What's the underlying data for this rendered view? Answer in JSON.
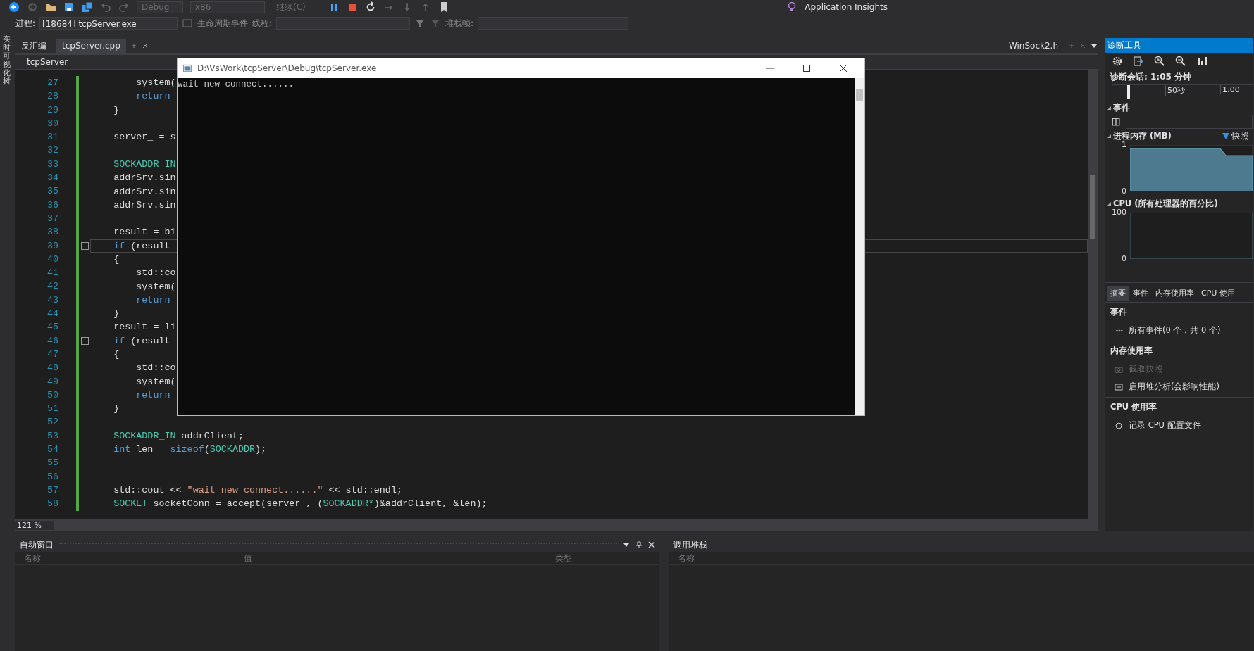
{
  "toolbar": {
    "items": [
      {
        "label": "Debug",
        "disabled": true
      },
      {
        "label": "x86",
        "disabled": true
      },
      {
        "label": "继续(C)",
        "disabled": true
      }
    ],
    "insights": "Application Insights"
  },
  "debug_bar": {
    "process_label": "进程:",
    "process": "[18684] tcpServer.exe",
    "lifecycle": "生命周期事件",
    "thread_label": "线程:",
    "stack_label": "堆栈帧:"
  },
  "side_strip": {
    "label": "实时可视化树"
  },
  "tabs": [
    {
      "label": "反汇编",
      "selected": false
    },
    {
      "label": "tcpServer.cpp",
      "selected": true
    }
  ],
  "right_tab": {
    "label": "WinSock2.h"
  },
  "nav": {
    "project": "tcpServer"
  },
  "code": {
    "lines": [
      {
        "number": "27",
        "fold": false,
        "current": false,
        "tokens": [
          {
            "text": "        system(",
            "kind": "plain"
          }
        ]
      },
      {
        "number": "28",
        "fold": false,
        "current": false,
        "tokens": [
          {
            "text": "        return",
            "kind": "keyword"
          }
        ]
      },
      {
        "number": "29",
        "fold": false,
        "current": false,
        "tokens": [
          {
            "text": "    }",
            "kind": "plain"
          }
        ]
      },
      {
        "number": "30",
        "fold": false,
        "current": false
      },
      {
        "number": "31",
        "fold": false,
        "current": false,
        "tokens": [
          {
            "text": "    server_ = s",
            "kind": "plain"
          }
        ]
      },
      {
        "number": "32",
        "fold": false,
        "current": false
      },
      {
        "number": "33",
        "fold": false,
        "current": false,
        "tokens": [
          {
            "text": "    SOCKADDR_IN",
            "kind": "type"
          }
        ]
      },
      {
        "number": "34",
        "fold": false,
        "current": false,
        "tokens": [
          {
            "text": "    addrSrv.sin",
            "kind": "plain"
          }
        ]
      },
      {
        "number": "35",
        "fold": false,
        "current": false,
        "tokens": [
          {
            "text": "    addrSrv.sin",
            "kind": "plain"
          }
        ]
      },
      {
        "number": "36",
        "fold": false,
        "current": false,
        "tokens": [
          {
            "text": "    addrSrv.sin",
            "kind": "plain"
          }
        ]
      },
      {
        "number": "37",
        "fold": false,
        "current": false
      },
      {
        "number": "38",
        "fold": false,
        "current": false,
        "tokens": [
          {
            "text": "    result = bi",
            "kind": "plain"
          }
        ]
      },
      {
        "number": "39",
        "fold": true,
        "current": true,
        "tokens": [
          {
            "text": "    if",
            "kind": "keyword"
          },
          {
            "text": " (result",
            "kind": "plain"
          }
        ]
      },
      {
        "number": "40",
        "fold": false,
        "current": false,
        "tokens": [
          {
            "text": "    {",
            "kind": "plain"
          }
        ]
      },
      {
        "number": "41",
        "fold": false,
        "current": false,
        "tokens": [
          {
            "text": "        std::co",
            "kind": "plain"
          }
        ]
      },
      {
        "number": "42",
        "fold": false,
        "current": false,
        "tokens": [
          {
            "text": "        system(",
            "kind": "plain"
          }
        ]
      },
      {
        "number": "43",
        "fold": false,
        "current": false,
        "tokens": [
          {
            "text": "        return",
            "kind": "keyword"
          }
        ]
      },
      {
        "number": "44",
        "fold": false,
        "current": false,
        "tokens": [
          {
            "text": "    }",
            "kind": "plain"
          }
        ]
      },
      {
        "number": "45",
        "fold": false,
        "current": false,
        "tokens": [
          {
            "text": "    result = li",
            "kind": "plain"
          }
        ]
      },
      {
        "number": "46",
        "fold": true,
        "current": false,
        "tokens": [
          {
            "text": "    if",
            "kind": "keyword"
          },
          {
            "text": " (result",
            "kind": "plain"
          }
        ]
      },
      {
        "number": "47",
        "fold": false,
        "current": false,
        "tokens": [
          {
            "text": "    {",
            "kind": "plain"
          }
        ]
      },
      {
        "number": "48",
        "fold": false,
        "current": false,
        "tokens": [
          {
            "text": "        std::co",
            "kind": "plain"
          }
        ]
      },
      {
        "number": "49",
        "fold": false,
        "current": false,
        "tokens": [
          {
            "text": "        system(",
            "kind": "plain"
          }
        ]
      },
      {
        "number": "50",
        "fold": false,
        "current": false,
        "tokens": [
          {
            "text": "        return",
            "kind": "keyword"
          }
        ]
      },
      {
        "number": "51",
        "fold": false,
        "current": false,
        "tokens": [
          {
            "text": "    }",
            "kind": "plain"
          }
        ]
      },
      {
        "number": "52",
        "fold": false,
        "current": false
      },
      {
        "number": "53",
        "fold": false,
        "current": false,
        "tokens": [
          {
            "text": "    SOCKADDR_IN",
            "kind": "type"
          },
          {
            "text": " addrClient;",
            "kind": "plain"
          }
        ]
      },
      {
        "number": "54",
        "fold": false,
        "current": false,
        "tokens": [
          {
            "text": "    int",
            "kind": "keyword"
          },
          {
            "text": " len = ",
            "kind": "plain"
          },
          {
            "text": "sizeof",
            "kind": "keyword"
          },
          {
            "text": "(",
            "kind": "plain"
          },
          {
            "text": "SOCKADDR",
            "kind": "type"
          },
          {
            "text": ");",
            "kind": "plain"
          }
        ]
      },
      {
        "number": "55",
        "fold": false,
        "current": false
      },
      {
        "number": "56",
        "fold": false,
        "current": false
      },
      {
        "number": "57",
        "fold": false,
        "current": false,
        "tokens": [
          {
            "text": "    std::cout << ",
            "kind": "plain"
          },
          {
            "text": "\"wait new connect......\"",
            "kind": "string"
          },
          {
            "text": " << std::endl;",
            "kind": "plain"
          }
        ]
      },
      {
        "number": "58",
        "fold": false,
        "current": false,
        "tokens": [
          {
            "text": "    SOCKET",
            "kind": "type"
          },
          {
            "text": " socketConn = accept(server_, (",
            "kind": "plain"
          },
          {
            "text": "SOCKADDR*",
            "kind": "type"
          },
          {
            "text": ")&addrClient, &len);",
            "kind": "plain"
          }
        ]
      }
    ]
  },
  "zoom": "121 %",
  "console": {
    "title": "D:\\VsWork\\tcpServer\\Debug\\tcpServer.exe",
    "output": [
      "wait new connect......"
    ]
  },
  "diagnostics": {
    "title": "诊断工具",
    "session": "诊断会话: 1:05 分钟",
    "ruler": [
      "50秒",
      "1:00"
    ],
    "events_label": "事件",
    "memory": {
      "title": "进程内存 (MB)",
      "legend": "快照",
      "axis_labels": [
        "1",
        "0"
      ]
    },
    "cpu": {
      "title": "CPU (所有处理器的百分比)",
      "axis_labels": [
        "100",
        "0"
      ]
    },
    "tabs": [
      {
        "label": "摘要",
        "selected": true
      },
      {
        "label": "事件",
        "selected": false
      },
      {
        "label": "内存使用率",
        "selected": false
      },
      {
        "label": "CPU 使用",
        "selected": false
      }
    ],
    "sections": [
      {
        "heading": "事件",
        "items": [
          {
            "kind": "events",
            "label": "所有事件(0 个，共 0 个)",
            "disabled": false
          }
        ]
      },
      {
        "heading": "内存使用率",
        "items": [
          {
            "kind": "camera",
            "label": "截取快照",
            "disabled": true
          },
          {
            "kind": "heap",
            "label": "启用堆分析(会影响性能)",
            "disabled": false
          }
        ]
      },
      {
        "heading": "CPU 使用率",
        "items": [
          {
            "kind": "radio",
            "label": "记录 CPU 配置文件",
            "disabled": false
          }
        ]
      }
    ]
  },
  "bottom": {
    "autos": {
      "title": "自动窗口",
      "columns": [
        "名称",
        "值",
        "类型"
      ]
    },
    "callstack": {
      "title": "调用堆栈",
      "columns": [
        "名称"
      ]
    }
  }
}
